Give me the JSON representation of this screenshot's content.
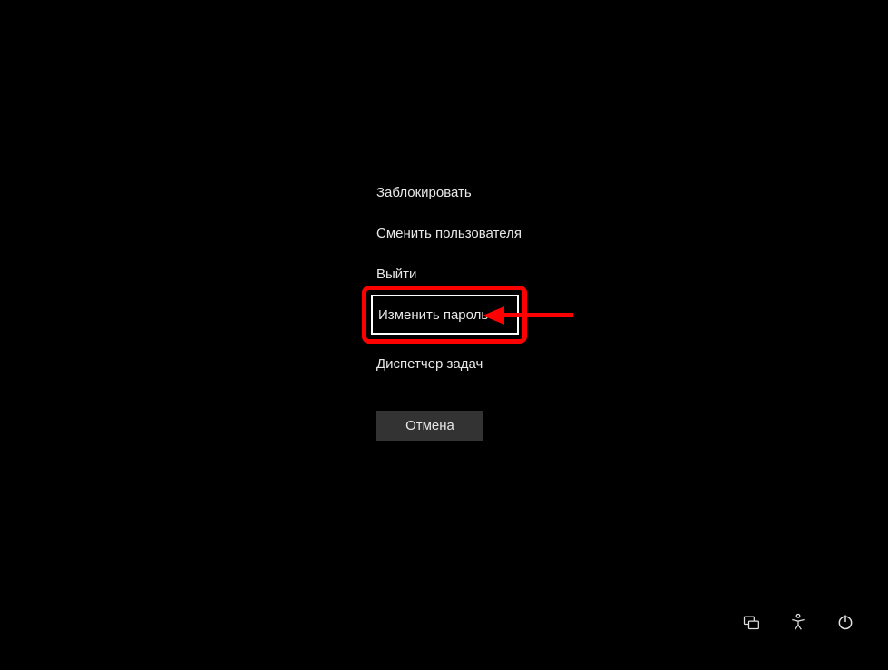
{
  "menu": {
    "lock": "Заблокировать",
    "switch_user": "Сменить пользователя",
    "sign_out": "Выйти",
    "change_password": "Изменить пароль",
    "task_manager": "Диспетчер задач"
  },
  "buttons": {
    "cancel": "Отмена"
  },
  "icons": {
    "network": "network-icon",
    "accessibility": "accessibility-icon",
    "power": "power-icon"
  }
}
